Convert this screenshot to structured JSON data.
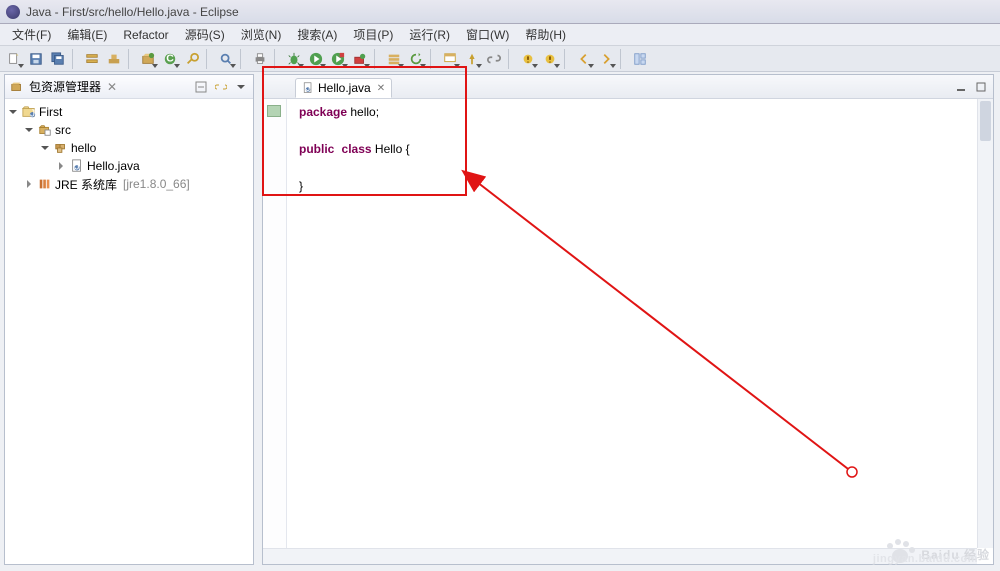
{
  "window": {
    "title": "Java - First/src/hello/Hello.java - Eclipse"
  },
  "menu": {
    "file": "文件(F)",
    "edit": "编辑(E)",
    "refactor": "Refactor",
    "source": "源码(S)",
    "navigate": "浏览(N)",
    "search": "搜索(A)",
    "project": "项目(P)",
    "run": "运行(R)",
    "window": "窗口(W)",
    "help": "帮助(H)"
  },
  "explorer": {
    "title": "包资源管理器",
    "project": "First",
    "src": "src",
    "pkg": "hello",
    "file": "Hello.java",
    "jre_label": "JRE 系统库",
    "jre_version": "[jre1.8.0_66]"
  },
  "editor": {
    "tab": "Hello.java",
    "code_line1_kw": "package",
    "code_line1_rest": " hello;",
    "code_line3_kw1": "public",
    "code_line3_kw2": "class",
    "code_line3_rest": " Hello {",
    "code_line5": "}"
  },
  "watermark": {
    "brand": "Baidu 经验",
    "url": "jingyan.baidu.com"
  }
}
